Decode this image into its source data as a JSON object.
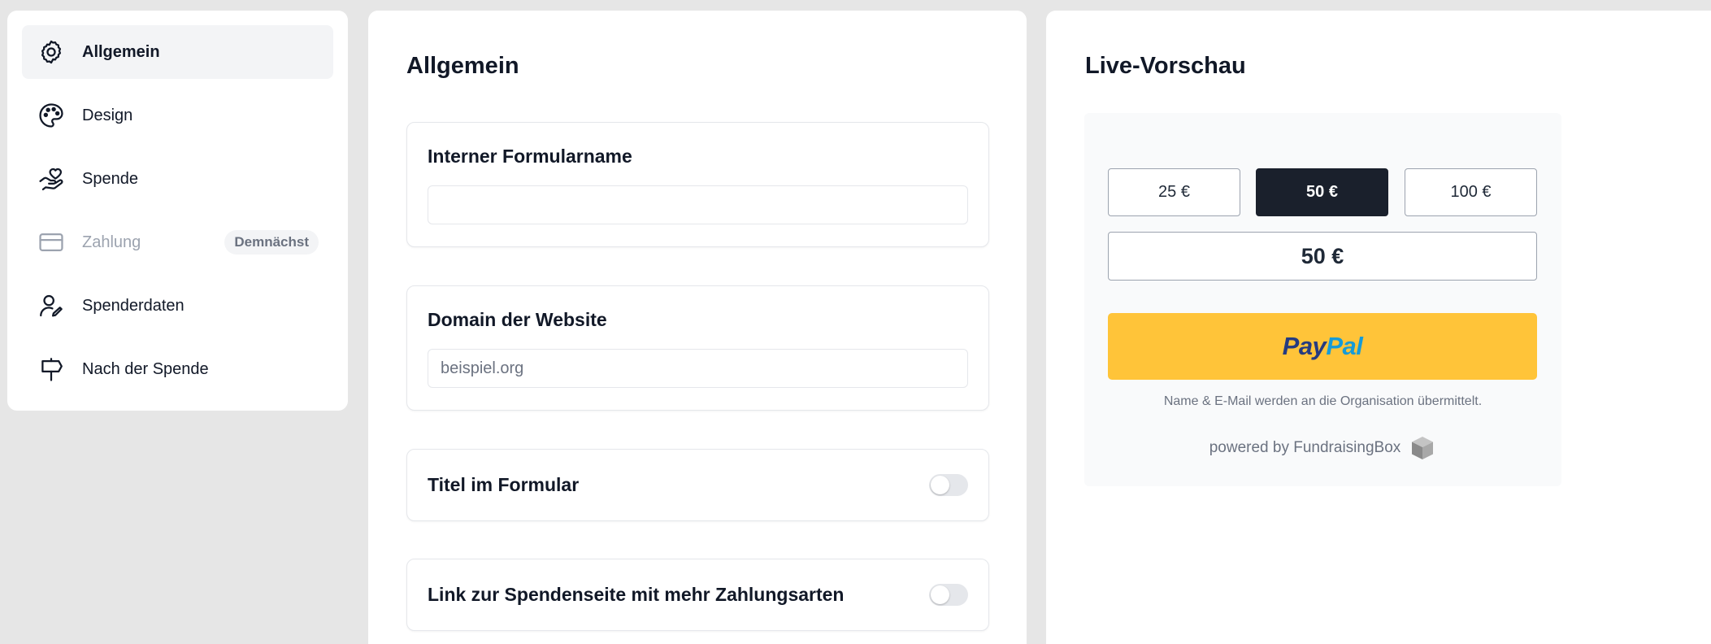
{
  "sidebar": {
    "items": [
      {
        "label": "Allgemein",
        "icon": "gear-icon",
        "active": true
      },
      {
        "label": "Design",
        "icon": "palette-icon"
      },
      {
        "label": "Spende",
        "icon": "hand-heart-icon"
      },
      {
        "label": "Zahlung",
        "icon": "credit-card-icon",
        "disabled": true,
        "badge": "Demnächst"
      },
      {
        "label": "Spenderdaten",
        "icon": "user-edit-icon"
      },
      {
        "label": "Nach der Spende",
        "icon": "signpost-icon"
      }
    ]
  },
  "settings": {
    "title": "Allgemein",
    "form_name": {
      "label": "Interner Formularname",
      "value": "",
      "placeholder": ""
    },
    "domain": {
      "label": "Domain der Website",
      "value": "",
      "placeholder": "beispiel.org"
    },
    "title_toggle": {
      "label": "Titel im Formular",
      "on": false
    },
    "link_toggle": {
      "label": "Link zur Spendenseite mit mehr Zahlungsarten",
      "on": false
    }
  },
  "preview": {
    "title": "Live-Vorschau",
    "amounts": [
      "25 €",
      "50 €",
      "100 €"
    ],
    "selected_amount_index": 1,
    "amount_value": "50 €",
    "paypal": {
      "pay": "Pay",
      "pal": "Pal"
    },
    "notice": "Name & E-Mail werden an die Organisation übermittelt.",
    "powered_by": "powered by FundraisingBox"
  },
  "colors": {
    "page_bg": "#e6e6e6",
    "selected_amount_bg": "#1a202c",
    "paypal_yellow": "#ffc439",
    "paypal_dark_blue": "#253b80",
    "paypal_light_blue": "#179bd7"
  }
}
